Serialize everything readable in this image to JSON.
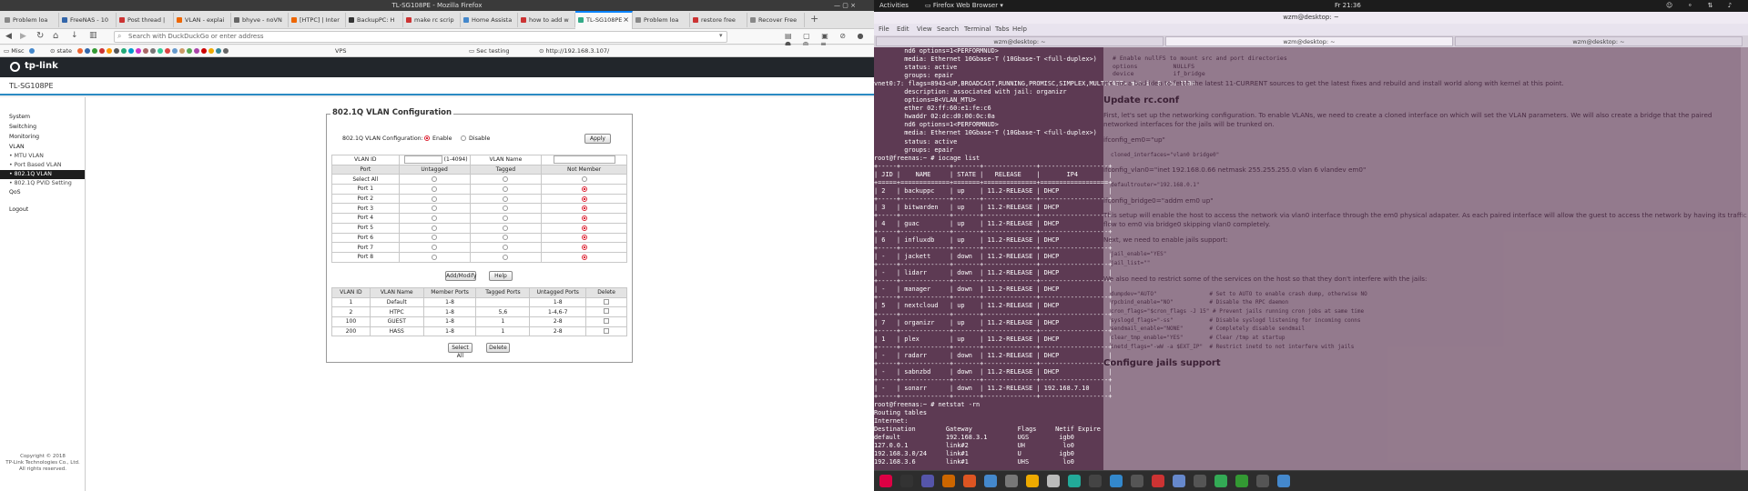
{
  "firefox": {
    "window_title": "TL-SG108PE - Mozilla Firefox",
    "tabs": [
      "Problem loa",
      "FreeNAS - 10",
      "Post thread |",
      "VLAN - explai",
      "bhyve - noVN",
      "[HTPC] | Inter",
      "BackupPC: H",
      "make rc scrip",
      "Home Assista",
      "how to add w",
      "TL-SG108PE",
      "Problem loa",
      "restore free",
      "Recover Free"
    ],
    "active_tab": 10,
    "url_placeholder": "Search with DuckDuckGo or enter address",
    "bookmarks": [
      "Misc",
      "state",
      "VPS",
      "Sec testing",
      "http://192.168.3.107/"
    ]
  },
  "tplink": {
    "brand": "tp-link",
    "model": "TL-SG108PE",
    "nav": [
      {
        "label": "System",
        "sub": false
      },
      {
        "label": "Switching",
        "sub": false
      },
      {
        "label": "Monitoring",
        "sub": false
      },
      {
        "label": "VLAN",
        "sub": false
      },
      {
        "label": "• MTU VLAN",
        "sub": true
      },
      {
        "label": "• Port Based VLAN",
        "sub": true
      },
      {
        "label": "• 802.1Q VLAN",
        "sub": true,
        "active": true
      },
      {
        "label": "• 802.1Q PVID Setting",
        "sub": true
      },
      {
        "label": "QoS",
        "sub": false
      },
      {
        "label": "Logout",
        "sub": false
      }
    ],
    "copyright": [
      "Copyright © 2018",
      "TP-Link Technologies Co., Ltd.",
      "All rights reserved."
    ],
    "panel_title": "802.1Q VLAN Configuration",
    "config_label": "802.1Q VLAN Configuration:",
    "enable_label": "Enable",
    "disable_label": "Disable",
    "apply_label": "Apply",
    "vlan_id_label": "VLAN ID",
    "vlan_id_hint": "(1-4094)",
    "vlan_name_label": "VLAN Name",
    "port_headers": [
      "Port",
      "Untagged",
      "Tagged",
      "Not Member"
    ],
    "select_all_label": "Select All",
    "ports": [
      "Port 1",
      "Port 2",
      "Port 3",
      "Port 4",
      "Port 5",
      "Port 6",
      "Port 7",
      "Port 8"
    ],
    "add_modify_label": "Add/Modify",
    "help_label": "Help",
    "vlan_table_headers": [
      "VLAN ID",
      "VLAN Name",
      "Member Ports",
      "Tagged Ports",
      "Untagged Ports",
      "Delete"
    ],
    "vlans": [
      {
        "id": "1",
        "name": "Default",
        "member": "1-8",
        "tagged": "",
        "untagged": "1-8"
      },
      {
        "id": "2",
        "name": "HTPC",
        "member": "1-8",
        "tagged": "5,6",
        "untagged": "1-4,6-7"
      },
      {
        "id": "100",
        "name": "GUEST",
        "member": "1-8",
        "tagged": "1",
        "untagged": "2-8"
      },
      {
        "id": "200",
        "name": "HASS",
        "member": "1-8",
        "tagged": "1",
        "untagged": "2-8"
      }
    ],
    "select_all_btn": "Select All",
    "delete_btn": "Delete"
  },
  "desktop": {
    "activities": "Activities",
    "app": "Firefox Web Browser",
    "clock": "Fr 21:36",
    "term_title": "wzm@desktop: ~",
    "menu": [
      "File",
      "Edit",
      "View",
      "Search",
      "Terminal",
      "Tabs",
      "Help"
    ],
    "term_tabs": [
      "wzm@desktop: ~",
      "wzm@desktop: ~",
      "wzm@desktop: ~"
    ]
  },
  "terminal_lines": [
    "        nd6 options=1<PERFORMNUD>",
    "        media: Ethernet 10Gbase-T (10Gbase-T <full-duplex>)",
    "        status: active",
    "        groups: epair",
    "vnet0:7: flags=8943<UP,BROADCAST,RUNNING,PROMISC,SIMPLEX,MULTICAST> metric 0 mtu 1500",
    "        description: associated with jail: organizr",
    "        options=8<VLAN_MTU>",
    "        ether 02:ff:60:e1:fe:c6",
    "        hwaddr 02:dc:d0:00:0c:0a",
    "        nd6 options=1<PERFORMNUD>",
    "        media: Ethernet 10Gbase-T (10Gbase-T <full-duplex>)",
    "        status: active",
    "        groups: epair",
    "root@freenas:~ # iocage list",
    "+-----+-------------+-------+--------------+------------------+",
    "| JID |    NAME     | STATE |   RELEASE    |       IP4        |",
    "+=====+=============+=======+==============+==================+",
    "| 2   | backuppc    | up    | 11.2-RELEASE | DHCP             |",
    "+-----+-------------+-------+--------------+------------------+",
    "| 3   | bitwarden   | up    | 11.2-RELEASE | DHCP             |",
    "+-----+-------------+-------+--------------+------------------+",
    "| 4   | guac        | up    | 11.2-RELEASE | DHCP             |",
    "+-----+-------------+-------+--------------+------------------+",
    "| 6   | influxdb    | up    | 11.2-RELEASE | DHCP             |",
    "+-----+-------------+-------+--------------+------------------+",
    "| -   | jackett     | down  | 11.2-RELEASE | DHCP             |",
    "+-----+-------------+-------+--------------+------------------+",
    "| -   | lidarr      | down  | 11.2-RELEASE | DHCP             |",
    "+-----+-------------+-------+--------------+------------------+",
    "| -   | manager     | down  | 11.2-RELEASE | DHCP             |",
    "+-----+-------------+-------+--------------+------------------+",
    "| 5   | nextcloud   | up    | 11.2-RELEASE | DHCP             |",
    "+-----+-------------+-------+--------------+------------------+",
    "| 7   | organizr    | up    | 11.2-RELEASE | DHCP             |",
    "+-----+-------------+-------+--------------+------------------+",
    "| 1   | plex        | up    | 11.2-RELEASE | DHCP             |",
    "+-----+-------------+-------+--------------+------------------+",
    "| -   | radarr      | down  | 11.2-RELEASE | DHCP             |",
    "+-----+-------------+-------+--------------+------------------+",
    "| -   | sabnzbd     | down  | 11.2-RELEASE | DHCP             |",
    "+-----+-------------+-------+--------------+------------------+",
    "| -   | sonarr      | down  | 11.2-RELEASE | 192.168.7.10     |",
    "+-----+-------------+-------+--------------+------------------+",
    "root@freenas:~ # netstat -rn",
    "Routing tables",
    "",
    "Internet:",
    "Destination        Gateway            Flags     Netif Expire",
    "default            192.168.3.1        UGS        igb0",
    "127.0.0.1          link#2             UH          lo0",
    "192.168.3.0/24     link#1             U          igb0",
    "192.168.3.6        link#1             UHS         lo0"
  ],
  "ghost_page": [
    "It's not a bad idea to fetch the latest 11-CURRENT sources to get the latest fixes and rebuild and install world along with kernel at this point.",
    "Update rc.conf",
    "First, let's set up the networking configuration. To enable VLANs, we need to create a cloned interface on which will set the VLAN parameters. We will also create a bridge that the paired networked interfaces for the jails will be trunked on.",
    "ifconfig_em0=\"up\"",
    "cloned_interfaces=\"vlan0 bridge0\"",
    "ifconfig_vlan0=\"inet 192.168.0.66 netmask 255.255.255.0 vlan 6 vlandev em0\"",
    "defaultrouter=\"192.168.0.1\"",
    "ifconfig_bridge0=\"addm em0 up\"",
    "This setup will enable the host to access the network via vlan0 interface through the em0 physical adapater. As each paired interface will allow the guest to access the network by having its traffic flow to em0 via bridge0 skipping vlan0 completely.",
    "Next, we need to enable jails support:",
    "jail_enable=\"YES\"",
    "jail_list=\"\"",
    "We also need to restrict some of the services on the host so that they don't interfere with the jails:",
    "dumpdev=\"AUTO\"                # Set to AUTO to enable crash dump, otherwise NO",
    "rpcbind_enable=\"NO\"           # Disable the RPC daemon",
    "cron_flags=\"$cron_flags -J 15\" # Prevent jails running cron jobs at same time",
    "syslogd_flags=\"-ss\"           # Disable syslogd listening for incoming conns",
    "sendmail_enable=\"NONE\"        # Completely disable sendmail",
    "clear_tmp_enable=\"YES\"        # Clear /tmp at startup",
    "inetd_flags=\"-wW -a $EXT_IP\"  # Restrict inetd to not interfere with jails",
    "Configure jails support"
  ],
  "ghost_top": [
    "# Enable nullFS to mount src and port directories",
    "options          NULLFS",
    "device           if_bridge"
  ]
}
